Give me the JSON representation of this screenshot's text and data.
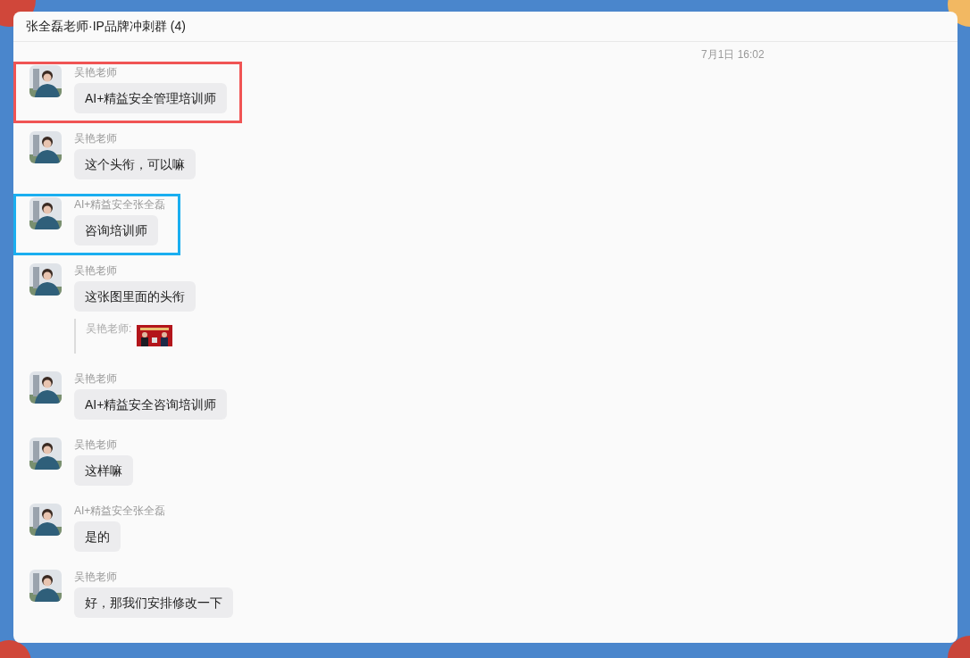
{
  "window": {
    "title": "张全磊老师·IP品牌冲刺群 (4)"
  },
  "timestamp": "7月1日 16:02",
  "messages": [
    {
      "sender": "吴艳老师",
      "text": "AI+精益安全管理培训师",
      "color": "#f05454"
    },
    {
      "sender": "吴艳老师",
      "text": "这个头衔，可以嘛"
    },
    {
      "sender": "AI+精益安全张全磊",
      "text": "咨询培训师",
      "color": "#1aaef0"
    },
    {
      "sender": "吴艳老师",
      "text": "这张图里面的头衔",
      "quote": {
        "sender": "吴艳老师:",
        "kind": "picture"
      }
    },
    {
      "sender": "吴艳老师",
      "text": "AI+精益安全咨询培训师"
    },
    {
      "sender": "吴艳老师",
      "text": "这样嘛"
    },
    {
      "sender": "AI+精益安全张全磊",
      "text": "是的"
    },
    {
      "sender": "吴艳老师",
      "text": "好，那我们安排修改一下"
    }
  ]
}
